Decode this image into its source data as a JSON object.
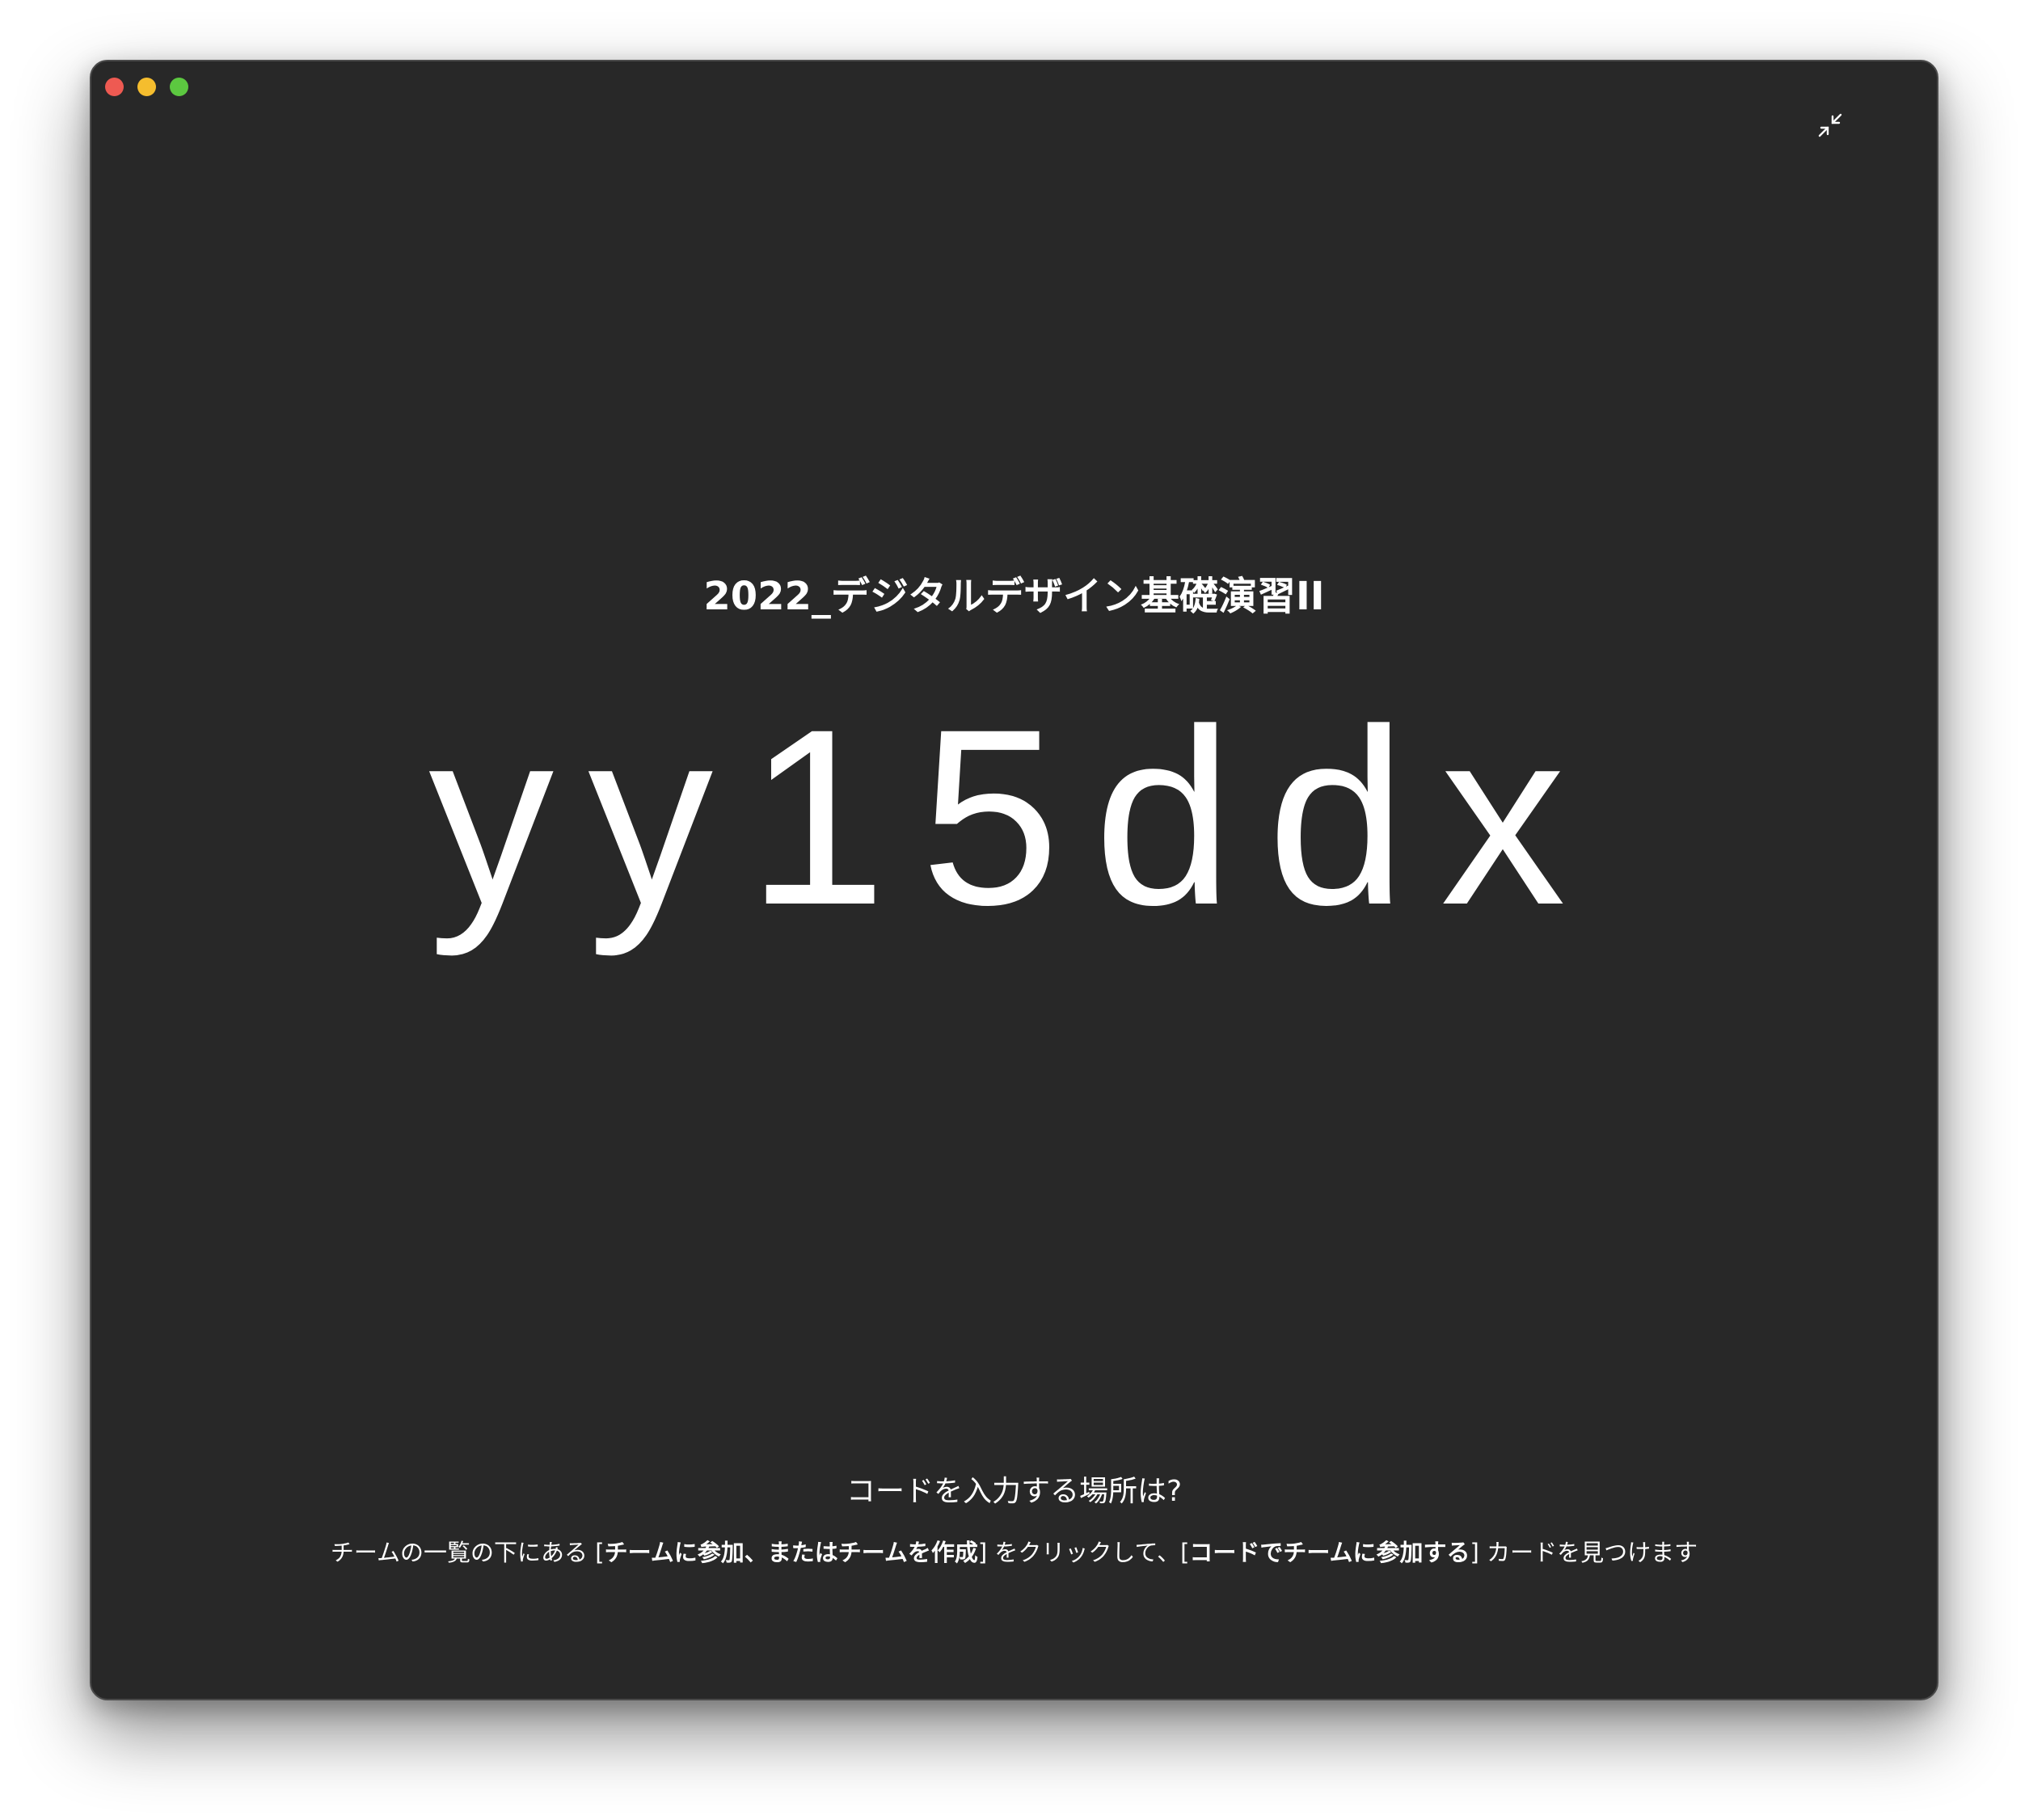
{
  "window": {
    "controls": [
      "close",
      "minimize",
      "zoom"
    ],
    "colors": {
      "background": "#282828",
      "close": "#ee5a52",
      "minimize": "#f5bd2e",
      "zoom": "#5cc840",
      "text": "#ffffff"
    }
  },
  "toolbar": {
    "collapse_icon": "collapse-arrows-icon"
  },
  "main": {
    "team_name": "2022_デジタルデザイン基礎演習II",
    "join_code": "yy15ddx",
    "help_question": "コードを入力する場所は?",
    "instruction": {
      "part1": "チームの一覧の下にある [",
      "bold1": "チームに参加、またはチームを作成",
      "part2": "] をクリックして、[",
      "bold2": "コードでチームに参加する",
      "part3": "] カードを見つけます"
    }
  }
}
